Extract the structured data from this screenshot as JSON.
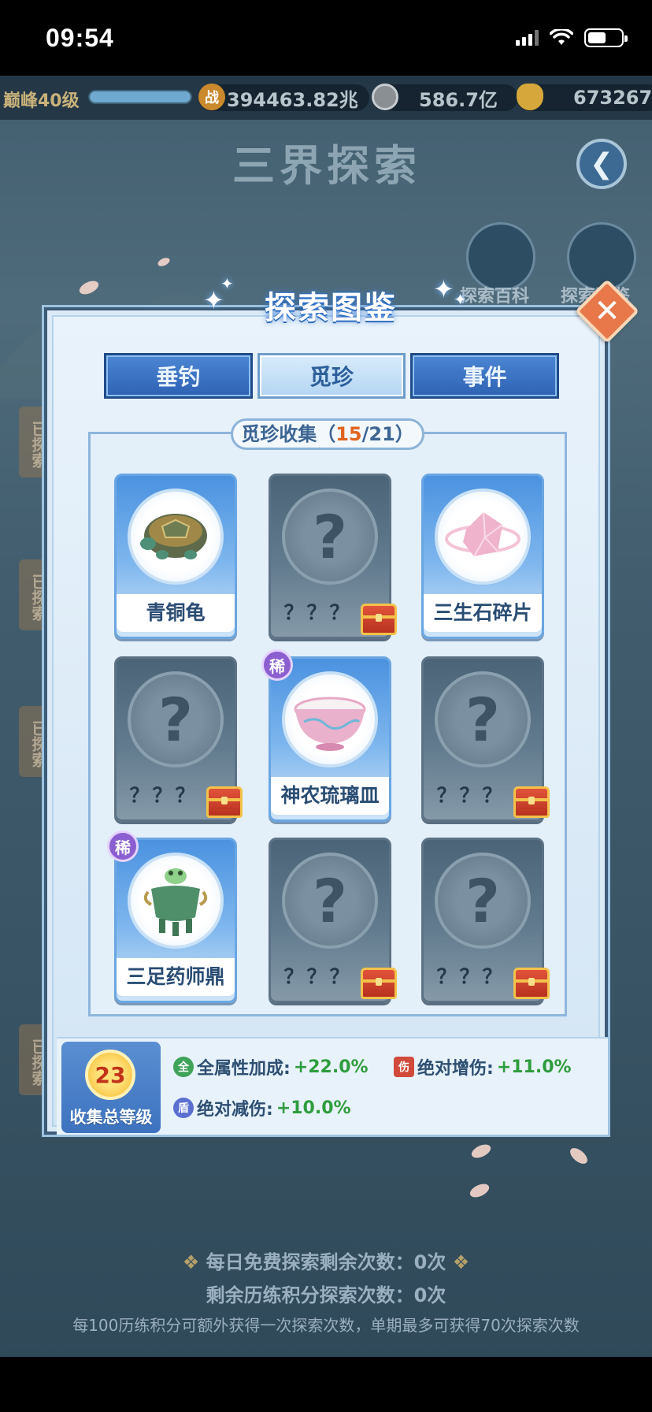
{
  "status_bar": {
    "time": "09:54"
  },
  "top_bar": {
    "level": "巅峰40级",
    "power": "394463.82兆",
    "coins": "586.7亿",
    "gold": "673267",
    "power_badge": "战"
  },
  "scene": {
    "title": "三界探索",
    "back_icon": "back-arrow-icon",
    "side_buttons": [
      "探索百科",
      "探索图鉴"
    ],
    "left_tabs": [
      "已探索",
      "已探索",
      "已探索",
      "已探索"
    ],
    "daily_free": "每日免费探索剩余次数：0次",
    "remaining": "剩余历练积分探索次数：0次",
    "hint": "每100历练积分可额外获得一次探索次数，单期最多可获得70次探索次数"
  },
  "panel": {
    "title": "探索图鉴",
    "close_icon": "close-icon",
    "tabs": [
      {
        "label": "垂钓",
        "active": false
      },
      {
        "label": "觅珍",
        "active": true
      },
      {
        "label": "事件",
        "active": false
      }
    ],
    "collection": {
      "label": "觅珍收集（",
      "current": "15",
      "total": "/21）",
      "cards": [
        {
          "name": "青铜龟",
          "known": true,
          "rare": false,
          "icon": "bronze-turtle-icon"
        },
        {
          "name": "？？？",
          "known": false,
          "rare": false,
          "icon": "question-mark-icon"
        },
        {
          "name": "三生石碎片",
          "known": true,
          "rare": false,
          "icon": "pink-crystal-icon"
        },
        {
          "name": "？？？",
          "known": false,
          "rare": false,
          "icon": "question-mark-icon"
        },
        {
          "name": "神农琉璃皿",
          "known": true,
          "rare": true,
          "icon": "glass-bowl-icon"
        },
        {
          "name": "？？？",
          "known": false,
          "rare": false,
          "icon": "question-mark-icon"
        },
        {
          "name": "三足药师鼎",
          "known": true,
          "rare": true,
          "icon": "jade-cauldron-icon"
        },
        {
          "name": "？？？",
          "known": false,
          "rare": false,
          "icon": "question-mark-icon"
        },
        {
          "name": "？？？",
          "known": false,
          "rare": false,
          "icon": "question-mark-icon"
        }
      ],
      "rare_badge": "稀",
      "question": "?"
    },
    "bonus": {
      "level": "23",
      "level_label": "收集总等级",
      "attrs": [
        {
          "label": "全属性加成:",
          "value": "+22.0%",
          "icon": "all-attr-icon",
          "icon_text": "全"
        },
        {
          "label": "绝对增伤:",
          "value": "+11.0%",
          "icon": "damage-up-icon",
          "icon_text": "伤"
        },
        {
          "label": "绝对减伤:",
          "value": "+10.0%",
          "icon": "damage-down-icon",
          "icon_text": "盾"
        }
      ]
    }
  },
  "colors": {
    "accent_blue": "#2f62b3",
    "highlight_orange": "#e0641e",
    "bonus_green": "#2f9d3e",
    "rare_purple": "#8b5fd0"
  }
}
